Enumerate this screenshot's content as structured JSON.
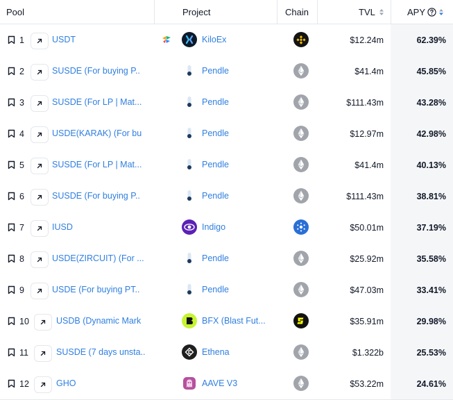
{
  "headers": {
    "pool": "Pool",
    "project": "Project",
    "chain": "Chain",
    "tvl": "TVL",
    "apy": "APY"
  },
  "colors": {
    "link": "#2f7fe0",
    "border": "#e5e7eb",
    "apy_bg": "#f5f6f8",
    "sort_arrow": "#2f7fe0"
  },
  "rows": [
    {
      "rank": "1",
      "pool": "USDT",
      "project": "KiloEx",
      "project_icon": "kiloex-icon",
      "chain_icon": "bnb-chain-icon",
      "tvl": "$12.24m",
      "apy": "62.39%"
    },
    {
      "rank": "2",
      "pool": "SUSDE (For buying P..",
      "project": "Pendle",
      "project_icon": "pendle-icon",
      "chain_icon": "ethereum-icon",
      "tvl": "$41.4m",
      "apy": "45.85%"
    },
    {
      "rank": "3",
      "pool": "SUSDE (For LP | Mat...",
      "project": "Pendle",
      "project_icon": "pendle-icon",
      "chain_icon": "ethereum-icon",
      "tvl": "$111.43m",
      "apy": "43.28%"
    },
    {
      "rank": "4",
      "pool": "USDE(KARAK) (For bu",
      "project": "Pendle",
      "project_icon": "pendle-icon",
      "chain_icon": "ethereum-icon",
      "tvl": "$12.97m",
      "apy": "42.98%"
    },
    {
      "rank": "5",
      "pool": "SUSDE (For LP | Mat...",
      "project": "Pendle",
      "project_icon": "pendle-icon",
      "chain_icon": "ethereum-icon",
      "tvl": "$41.4m",
      "apy": "40.13%"
    },
    {
      "rank": "6",
      "pool": "SUSDE (For buying P..",
      "project": "Pendle",
      "project_icon": "pendle-icon",
      "chain_icon": "ethereum-icon",
      "tvl": "$111.43m",
      "apy": "38.81%"
    },
    {
      "rank": "7",
      "pool": "IUSD",
      "project": "Indigo",
      "project_icon": "indigo-icon",
      "chain_icon": "cardano-icon",
      "tvl": "$50.01m",
      "apy": "37.19%"
    },
    {
      "rank": "8",
      "pool": "USDE(ZIRCUIT) (For ...",
      "project": "Pendle",
      "project_icon": "pendle-icon",
      "chain_icon": "ethereum-icon",
      "tvl": "$25.92m",
      "apy": "35.58%"
    },
    {
      "rank": "9",
      "pool": "USDE (For buying PT..",
      "project": "Pendle",
      "project_icon": "pendle-icon",
      "chain_icon": "ethereum-icon",
      "tvl": "$47.03m",
      "apy": "33.41%"
    },
    {
      "rank": "10",
      "pool": "USDB (Dynamic Mark",
      "project": "BFX (Blast Fut...",
      "project_icon": "bfx-icon",
      "chain_icon": "blast-icon",
      "tvl": "$35.91m",
      "apy": "29.98%"
    },
    {
      "rank": "11",
      "pool": "SUSDE (7 days unsta..",
      "project": "Ethena",
      "project_icon": "ethena-icon",
      "chain_icon": "ethereum-icon",
      "tvl": "$1.322b",
      "apy": "25.53%"
    },
    {
      "rank": "12",
      "pool": "GHO",
      "project": "AAVE V3",
      "project_icon": "aave-icon",
      "chain_icon": "ethereum-icon",
      "tvl": "$53.22m",
      "apy": "24.61%"
    }
  ]
}
